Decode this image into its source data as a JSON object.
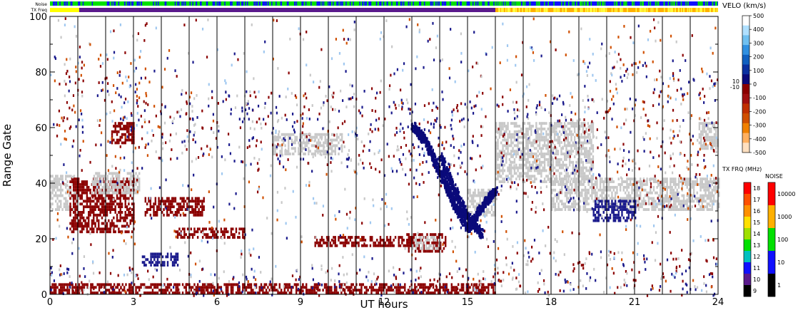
{
  "chart_data": {
    "type": "scatter",
    "title": "",
    "xlabel": "UT hours",
    "ylabel": "Range Gate",
    "xlim": [
      0,
      24
    ],
    "ylim": [
      0,
      100
    ],
    "xticks": [
      0,
      3,
      6,
      9,
      12,
      15,
      18,
      21,
      24
    ],
    "yticks": [
      0,
      20,
      40,
      60,
      80,
      100
    ],
    "hour_lines": [
      1,
      2,
      3,
      4,
      5,
      6,
      7,
      8,
      9,
      10,
      11,
      12,
      13,
      14,
      15,
      16,
      17,
      18,
      19,
      20,
      21,
      22,
      23
    ],
    "top_bars": {
      "noise_label": "Noise",
      "txfreq_label": "TX Freq",
      "noise_segments": [
        {
          "t0": 0.0,
          "t1": 16.0,
          "color": "#00e000"
        },
        {
          "t0": 16.0,
          "t1": 24.0,
          "color": "#1010ff"
        }
      ],
      "txfreq_segments": [
        {
          "t0": 0.0,
          "t1": 1.05,
          "color": "#ffff00"
        },
        {
          "t0": 1.05,
          "t1": 16.0,
          "color": "#5a1a8c"
        },
        {
          "t0": 16.0,
          "t1": 24.0,
          "color": "#ffb000"
        }
      ]
    },
    "bands": [
      {
        "t0": 0.0,
        "t1": 1.0,
        "g0": 30,
        "g1": 43,
        "color": "#c8c8c8"
      },
      {
        "t0": 0.7,
        "t1": 3.0,
        "g0": 22,
        "g1": 42,
        "color": "#8b0000"
      },
      {
        "t0": 1.5,
        "t1": 3.2,
        "g0": 36,
        "g1": 44,
        "color": "#c8c8c8"
      },
      {
        "t0": 2.2,
        "t1": 3.0,
        "g0": 54,
        "g1": 62,
        "color": "#8b0000"
      },
      {
        "t0": 3.4,
        "t1": 5.5,
        "g0": 28,
        "g1": 35,
        "color": "#8b0000"
      },
      {
        "t0": 3.3,
        "t1": 4.6,
        "g0": 10,
        "g1": 15,
        "color": "#1a1a8c"
      },
      {
        "t0": 4.5,
        "t1": 7.0,
        "g0": 20,
        "g1": 24,
        "color": "#8b0000"
      },
      {
        "t0": 9.5,
        "t1": 13.0,
        "g0": 17,
        "g1": 21,
        "color": "#8b0000"
      },
      {
        "t0": 12.8,
        "t1": 14.2,
        "g0": 15,
        "g1": 22,
        "color": "#8b0000"
      },
      {
        "t0": 13.0,
        "t1": 14.0,
        "g0": 16,
        "g1": 21,
        "color": "#c8c8c8"
      },
      {
        "t0": 0.0,
        "t1": 16.0,
        "g0": 0,
        "g1": 4,
        "color": "#8b0000"
      },
      {
        "t0": 8.0,
        "t1": 10.5,
        "g0": 50,
        "g1": 58,
        "color": "#c8c8c8"
      },
      {
        "t0": 15.0,
        "t1": 16.0,
        "g0": 28,
        "g1": 38,
        "color": "#c8c8c8"
      },
      {
        "t0": 16.0,
        "t1": 19.5,
        "g0": 40,
        "g1": 62,
        "color": "#c8c8c8"
      },
      {
        "t0": 18.0,
        "t1": 24.0,
        "g0": 30,
        "g1": 42,
        "color": "#c8c8c8"
      },
      {
        "t0": 19.5,
        "t1": 21.0,
        "g0": 26,
        "g1": 34,
        "color": "#1a1a8c"
      },
      {
        "t0": 23.3,
        "t1": 24.0,
        "g0": 52,
        "g1": 62,
        "color": "#c8c8c8"
      }
    ],
    "tracks": [
      {
        "name": "",
        "color": "#0a0a7a",
        "points": [
          [
            13.0,
            61
          ],
          [
            13.5,
            55
          ],
          [
            14.0,
            44
          ],
          [
            14.5,
            33
          ],
          [
            15.0,
            24
          ],
          [
            15.5,
            32
          ],
          [
            16.0,
            38
          ]
        ]
      },
      {
        "name": "",
        "color": "#0a0a7a",
        "points": [
          [
            14.0,
            50
          ],
          [
            14.5,
            38
          ],
          [
            15.0,
            28
          ],
          [
            15.5,
            22
          ]
        ]
      }
    ],
    "scatter_regions": [
      {
        "t0": 0.3,
        "t1": 1.2,
        "g0": 48,
        "g1": 85,
        "colors": [
          "#8b0000",
          "#1a1a8c",
          "#8b0000",
          "#d05000"
        ]
      },
      {
        "t0": 1.7,
        "t1": 3.5,
        "g0": 44,
        "g1": 88,
        "colors": [
          "#8b0000",
          "#1a1a8c",
          "#d05000",
          "#a0c8f0"
        ]
      },
      {
        "t0": 3.5,
        "t1": 5.2,
        "g0": 48,
        "g1": 70,
        "colors": [
          "#8b0000",
          "#1a1a8c",
          "#c8c8c8"
        ]
      },
      {
        "t0": 5.0,
        "t1": 7.5,
        "g0": 48,
        "g1": 74,
        "colors": [
          "#8b0000",
          "#1a1a8c",
          "#c8c8c8"
        ]
      },
      {
        "t0": 7.0,
        "t1": 10.0,
        "g0": 44,
        "g1": 72,
        "colors": [
          "#8b0000",
          "#1a1a8c",
          "#c8c8c8"
        ]
      },
      {
        "t0": 10.0,
        "t1": 13.0,
        "g0": 44,
        "g1": 76,
        "colors": [
          "#8b0000",
          "#1a1a8c",
          "#c8c8c8"
        ]
      },
      {
        "t0": 12.5,
        "t1": 15.5,
        "g0": 40,
        "g1": 70,
        "colors": [
          "#1a1a8c",
          "#8b0000"
        ]
      },
      {
        "t0": 16.0,
        "t1": 20.0,
        "g0": 30,
        "g1": 72,
        "colors": [
          "#1a1a8c",
          "#8b0000",
          "#c8c8c8"
        ]
      },
      {
        "t0": 20.0,
        "t1": 24.0,
        "g0": 30,
        "g1": 85,
        "colors": [
          "#8b0000",
          "#1a1a8c",
          "#d05000",
          "#c8c8c8"
        ]
      },
      {
        "t0": 0.0,
        "t1": 16.0,
        "g0": 0,
        "g1": 10,
        "colors": [
          "#1a1a8c",
          "#8b0000",
          "#c8c8c8"
        ]
      },
      {
        "t0": 16.0,
        "t1": 24.0,
        "g0": 0,
        "g1": 16,
        "colors": [
          "#8b0000",
          "#1a1a8c",
          "#c8c8c8"
        ]
      },
      {
        "t0": 0.0,
        "t1": 24.0,
        "g0": 0,
        "g1": 100,
        "colors": [
          "#8b0000",
          "#1a1a8c",
          "#a0c8f0",
          "#d05000",
          "#c8c8c8"
        ]
      }
    ],
    "velo_colorbar": {
      "title": "VELO (km/s)",
      "min": -500,
      "max": 500,
      "labels": [
        "500",
        "400",
        "300",
        "200",
        "100",
        "0",
        "-100",
        "-200",
        "-300",
        "-400",
        "-500"
      ],
      "side_labels": [
        "10",
        "-10"
      ],
      "colors": [
        "#ffffff",
        "#b0e0ff",
        "#70c0f0",
        "#3090e0",
        "#1060c0",
        "#0a30a0",
        "#0a0a7a",
        "#8b0000",
        "#a01010",
        "#c03000",
        "#d05000",
        "#f08000",
        "#ffb060",
        "#ffe0c0"
      ]
    },
    "txfreq_colorbar": {
      "title": "TX FRQ (MHz)",
      "labels": [
        "18",
        "17",
        "16",
        "15",
        "14",
        "13",
        "12",
        "11",
        "10",
        "9"
      ],
      "colors": [
        "#ff0000",
        "#ff5000",
        "#ff9000",
        "#ffe000",
        "#a0e000",
        "#00e000",
        "#00c0c0",
        "#1010ff",
        "#5a1a8c",
        "#000000"
      ]
    },
    "noise_colorbar": {
      "title": "NOISE",
      "labels": [
        "10000",
        "1000",
        "100",
        "10",
        "1"
      ],
      "colors": [
        "#ff0000",
        "#ffb000",
        "#00e000",
        "#1010ff",
        "#000000"
      ]
    }
  }
}
